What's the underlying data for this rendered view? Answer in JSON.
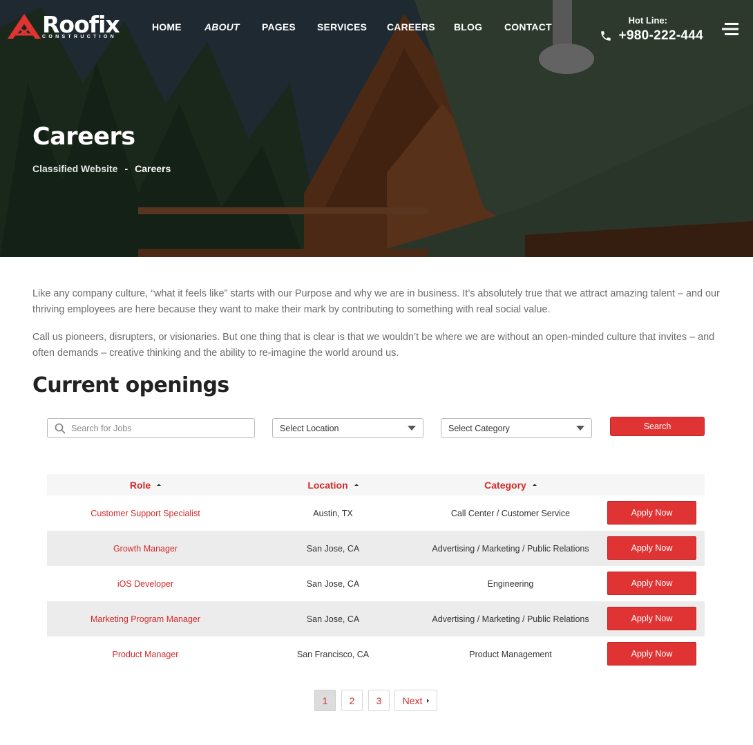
{
  "brand": {
    "name": "Roofix",
    "tagline": "CONSTRUCTION",
    "accent": "#e03434"
  },
  "nav": {
    "items": [
      {
        "label": "HOME",
        "active": false
      },
      {
        "label": "ABOUT",
        "active": true
      },
      {
        "label": "PAGES",
        "active": false
      },
      {
        "label": "SERVICES",
        "active": false
      },
      {
        "label": "CAREERS",
        "active": false
      },
      {
        "label": "BLOG",
        "active": false
      },
      {
        "label": "CONTACT",
        "active": false
      }
    ]
  },
  "hotline": {
    "label": "Hot Line:",
    "number": "+980-222-444",
    "icon": "phone-icon"
  },
  "hero": {
    "title": "Careers",
    "breadcrumb": [
      "Classified Website",
      "-",
      "Careers"
    ]
  },
  "intro": {
    "p1": "Like any company culture, “what it feels like” starts with our Purpose and why we are in business. It’s absolutely true that we attract amazing talent – and our thriving employees are here because they want to make their mark by contributing to something with real social value.",
    "p2": "Call us pioneers, disrupters, or visionaries. But one thing that is clear is that we wouldn’t be where we are without an open-minded culture that invites – and often demands – creative thinking and the ability to re-imagine the world around us."
  },
  "openings": {
    "title": "Current openings",
    "search_placeholder": "Search for Jobs",
    "location_select": "Select Location",
    "category_select": "Select Category",
    "search_button": "Search",
    "columns": [
      "Role",
      "Location",
      "Category"
    ],
    "apply_label": "Apply Now",
    "rows": [
      {
        "role": "Customer Support Specialist",
        "location": "Austin, TX",
        "category": "Call Center / Customer Service"
      },
      {
        "role": "Growth Manager",
        "location": "San Jose, CA",
        "category": "Advertising / Marketing / Public Relations"
      },
      {
        "role": "iOS Developer",
        "location": "San Jose, CA",
        "category": "Engineering"
      },
      {
        "role": "Marketing Program Manager",
        "location": "San Jose, CA",
        "category": "Advertising / Marketing / Public Relations"
      },
      {
        "role": "Product Manager",
        "location": "San Francisco, CA",
        "category": "Product Management"
      }
    ]
  },
  "pagination": {
    "pages": [
      "1",
      "2",
      "3"
    ],
    "current": "1",
    "next_label": "Next"
  }
}
